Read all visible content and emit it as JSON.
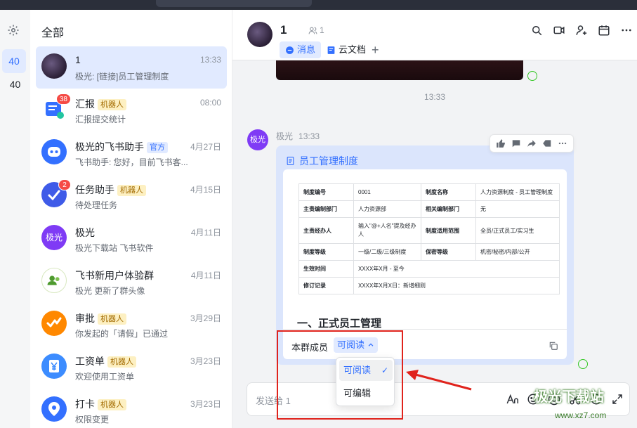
{
  "sidebar_rail": {
    "items": [
      "40",
      "40"
    ]
  },
  "list": {
    "title": "全部",
    "conversations": [
      {
        "name": "1",
        "time": "13:33",
        "preview": "极光: [链接]员工管理制度",
        "tag": "",
        "badge": ""
      },
      {
        "name": "汇报",
        "time": "08:00",
        "preview": "汇报提交统计",
        "tag": "机器人",
        "badge": "38"
      },
      {
        "name": "极光的飞书助手",
        "time": "4月27日",
        "preview": "飞书助手: 您好，目前飞书客...",
        "tag": "官方",
        "badge": ""
      },
      {
        "name": "任务助手",
        "time": "4月15日",
        "preview": "待处理任务",
        "tag": "机器人",
        "badge": "2"
      },
      {
        "name": "极光",
        "time": "4月11日",
        "preview": "极光下载站 飞书软件",
        "tag": "",
        "badge": ""
      },
      {
        "name": "飞书新用户体验群",
        "time": "4月11日",
        "preview": "极光 更新了群头像",
        "tag": "",
        "badge": ""
      },
      {
        "name": "审批",
        "time": "3月29日",
        "preview": "你发起的「请假」已通过",
        "tag": "机器人",
        "badge": ""
      },
      {
        "name": "工资单",
        "time": "3月23日",
        "preview": "欢迎使用工资单",
        "tag": "机器人",
        "badge": ""
      },
      {
        "name": "打卡",
        "time": "3月23日",
        "preview": "权限变更",
        "tag": "机器人",
        "badge": ""
      }
    ],
    "jiguang_avatar_text": "极光"
  },
  "chat": {
    "title": "1",
    "member_count": "1",
    "tabs": {
      "messages": "消息",
      "docs": "云文档",
      "add": "+"
    },
    "time_divider": "13:33",
    "message": {
      "sender": "极光",
      "time": "13:33",
      "avatar_text": "极光",
      "card_title": "员工管理制度",
      "doc_table": [
        [
          "制度编号",
          "0001",
          "制度名称",
          "人力资源制度 - 员工管理制度"
        ],
        [
          "主责编制部门",
          "人力资源部",
          "相关编制部门",
          "无"
        ],
        [
          "主责经办人",
          "输入\"@+人名\"提及经办人",
          "制度适用范围",
          "全员/正式员工/实习生"
        ],
        [
          "制度等级",
          "一级/二级/三级制度",
          "保密等级",
          "机密/秘密/内部/公开"
        ],
        [
          "生效时间",
          "XXXX年X月 - 至今"
        ],
        [
          "修订记录",
          "XXXX年X月X日：新增细则"
        ]
      ],
      "doc_heading": "一、正式员工管理",
      "permission_label": "本群成员",
      "permission_value": "可阅读"
    },
    "dropdown": {
      "options": [
        "可阅读",
        "可编辑"
      ],
      "selected": "可阅读",
      "check": "✓"
    },
    "composer": {
      "placeholder": "发送给 1"
    }
  },
  "watermark": {
    "text": "极光下载站",
    "url": "www.xz7.com"
  },
  "colors": {
    "accent": "#3370ff",
    "highlight_box": "#e0231c",
    "read_check": "#34c724"
  }
}
